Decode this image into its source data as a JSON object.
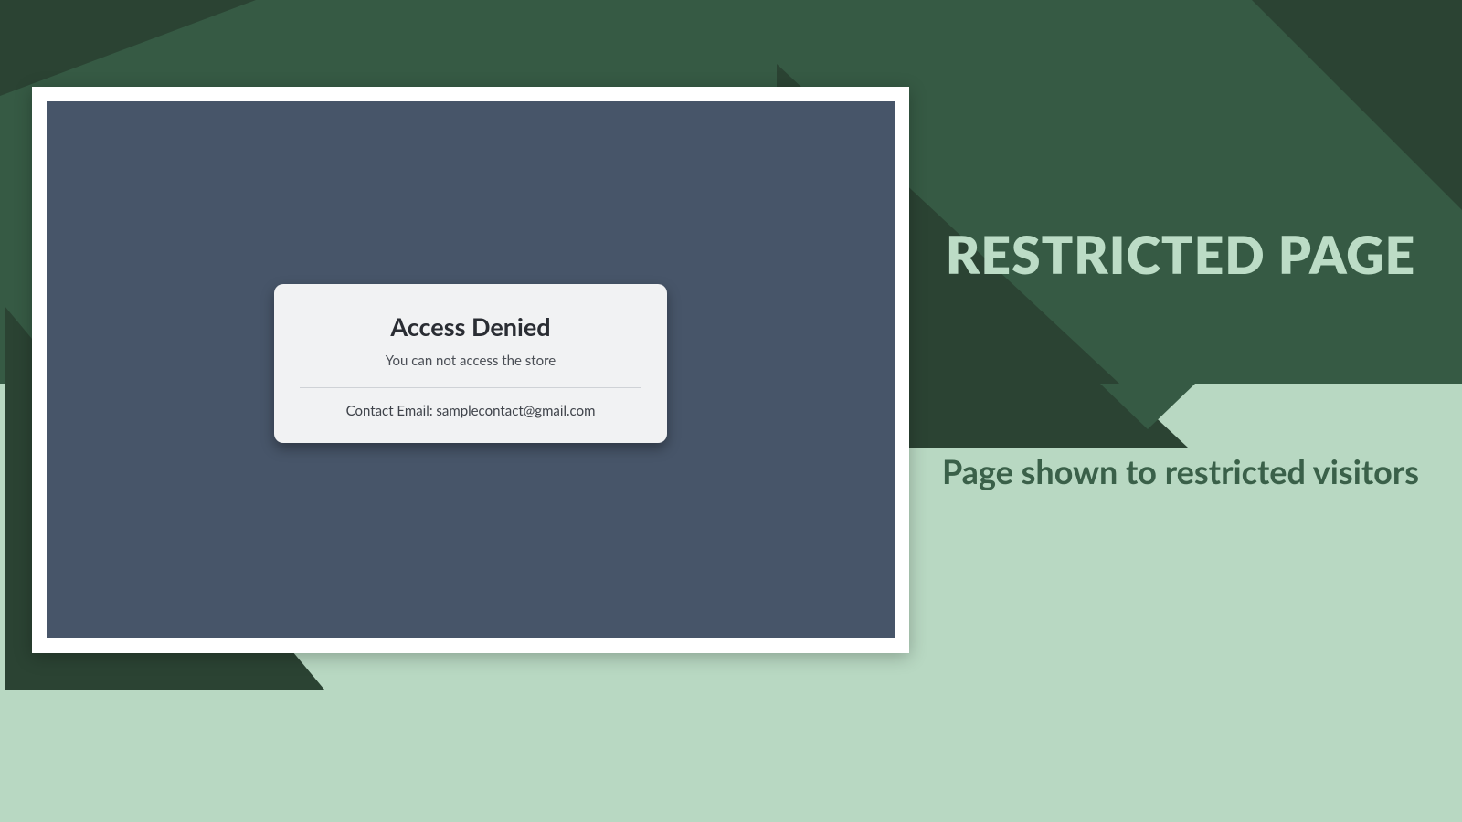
{
  "slide": {
    "heading": "RESTRICTED PAGE",
    "subtitle": "Page shown to restricted visitors"
  },
  "card": {
    "title": "Access Denied",
    "message": "You can not access the store",
    "contact": "Contact Email: samplecontact@gmail.com"
  },
  "colors": {
    "bg_light": "#b8d8c2",
    "bg_dark": "#365a44",
    "bg_darker": "#2b4333",
    "screenshot_bg": "#475569",
    "card_bg": "#f1f2f3"
  }
}
